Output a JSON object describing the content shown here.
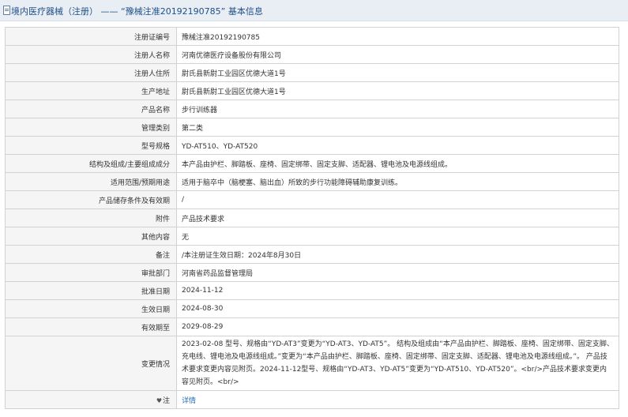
{
  "header": {
    "title": "境内医疗器械（注册） —— “豫械注准20192190785” 基本信息"
  },
  "rows": [
    {
      "key": "注册证编号",
      "value": "豫械注准20192190785"
    },
    {
      "key": "注册人名称",
      "value": "河南优德医疗设备股份有限公司"
    },
    {
      "key": "注册人住所",
      "value": "尉氏县新尉工业园区优德大道1号"
    },
    {
      "key": "生产地址",
      "value": "尉氏县新尉工业园区优德大道1号"
    },
    {
      "key": "产品名称",
      "value": "步行训练器"
    },
    {
      "key": "管理类别",
      "value": "第二类"
    },
    {
      "key": "型号规格",
      "value": "YD-AT510、YD-AT520"
    },
    {
      "key": "结构及组成/主要组成成分",
      "value": "本产品由护栏、脚踏板、座椅、固定绑带、固定支脚、适配器、锂电池及电源线组成。"
    },
    {
      "key": "适用范围/预期用途",
      "value": "适用于脑卒中（脑梗塞、脑出血）所致的步行功能障碍辅助康复训练。"
    },
    {
      "key": "产品储存条件及有效期",
      "value": "/"
    },
    {
      "key": "附件",
      "value": "产品技术要求"
    },
    {
      "key": "其他内容",
      "value": "无"
    },
    {
      "key": "备注",
      "value": "/本注册证生效日期：2024年8月30日"
    },
    {
      "key": "审批部门",
      "value": "河南省药品监督管理局"
    },
    {
      "key": "批准日期",
      "value": "2024-11-12"
    },
    {
      "key": "生效日期",
      "value": "2024-08-30"
    },
    {
      "key": "有效期至",
      "value": "2029-08-29"
    },
    {
      "key": "变更情况",
      "value": "2023-02-08 型号、规格由“YD-AT3”变更为“YD-AT3、YD-AT5”。 结构及组成由“本产品由护栏、脚踏板、座椅、固定绑带、固定支脚、充电线、锂电池及电源线组成。”变更为“本产品由护栏、脚踏板、座椅、固定绑带、固定支脚、适配器、锂电池及电源线组成。”。 产品技术要求变更内容见附页。2024-11-12型号、规格由“YD-AT3、YD-AT5”变更为“YD-AT510、YD-AT520”。<br/>产品技术要求变更内容见附页。<br/>"
    }
  ],
  "note_row": {
    "icon": "pin-icon",
    "icon_glyph": "♥",
    "key": "注",
    "link_label": "详情"
  }
}
